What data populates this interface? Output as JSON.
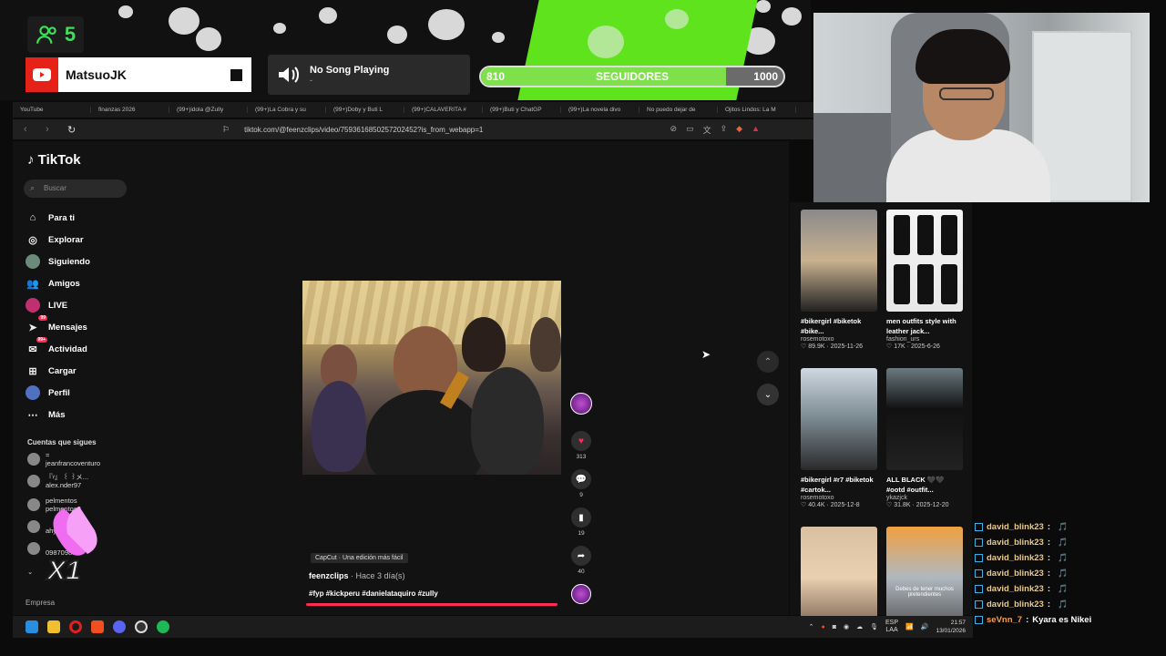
{
  "overlay": {
    "viewer_count": "5",
    "channel_name": "MatsuoJK",
    "song_title": "No Song Playing",
    "song_sub": "-",
    "goal_current": "810",
    "goal_label": "SEGUIDORES",
    "goal_target": "1000",
    "goal_progress_fraction": 0.81
  },
  "browser": {
    "tabs": [
      "YouTube",
      "finanzas 2026",
      "(99+)idola @Zully",
      "(99+)La Cobra y su",
      "(99+)Doby y Buti L",
      "(99+)CALAVERITA #",
      "(99+)Buti y ChatGP",
      "(99+)La novela divo",
      "No puedo dejar de",
      "Ojitos Lindos: La M"
    ],
    "url": "tiktok.com/@feenzclips/video/7593616850257202452?is_from_webapp=1"
  },
  "tiktok": {
    "logo": "TikTok",
    "search_placeholder": "Buscar",
    "menu": [
      {
        "label": "Para ti",
        "icon": "home-icon"
      },
      {
        "label": "Explorar",
        "icon": "compass-icon"
      },
      {
        "label": "Siguiendo",
        "icon": "avatar-icon"
      },
      {
        "label": "Amigos",
        "icon": "friends-icon"
      },
      {
        "label": "LIVE",
        "icon": "live-icon"
      },
      {
        "label": "Mensajes",
        "icon": "send-icon",
        "badge": "99"
      },
      {
        "label": "Actividad",
        "icon": "inbox-icon",
        "badge": "99+"
      },
      {
        "label": "Cargar",
        "icon": "upload-icon"
      },
      {
        "label": "Perfil",
        "icon": "profile-icon"
      },
      {
        "label": "Más",
        "icon": "more-icon"
      }
    ],
    "following_header": "Cuentas que sigues",
    "accounts": [
      {
        "line1": "=",
        "line2": "jeanfrancoventuro"
      },
      {
        "line1": "『ᵞ』 ꒰ ꒱メ...",
        "line2": "alex.nder97"
      },
      {
        "line1": "pelmentos",
        "line2": "pelmentos0"
      },
      {
        "line1": "",
        "line2": "ahyaaa"
      },
      {
        "line1": "",
        "line2": "098709877"
      }
    ],
    "footer": "Empresa",
    "video": {
      "capcut": "CapCut · Una edición más fácil",
      "author": "feenzclips",
      "time": "· Hace 3 día(s)",
      "tags": "#fyp #kickperu #danielataquiro #zully",
      "likes": "313",
      "comments": "9",
      "saves": "19",
      "shares": "40"
    },
    "grid": [
      {
        "title": "#bikergirl #biketok #bike...",
        "author": "rosemotoxo",
        "views": "89.9K",
        "date": "2025-11-26"
      },
      {
        "title": "men outfits style with leather jack...",
        "author": "fashion_urs",
        "views": "17K",
        "date": "2025-6-26"
      },
      {
        "title": "#bikergirl #r7 #biketok #cartok...",
        "author": "rosemotoxo",
        "views": "40.4K",
        "date": "2025-12-8"
      },
      {
        "title": "ALL BLACK 🖤🖤 #ootd #outfit...",
        "author": "ykazjck",
        "views": "31.8K",
        "date": "2025-12-20"
      },
      {
        "title": "",
        "author": "",
        "views": "",
        "date": ""
      },
      {
        "title": "",
        "author": "",
        "views": "",
        "date": "",
        "overlay_text": "Debes de tener muchos pretendientes"
      }
    ]
  },
  "chat": [
    {
      "user": "david_blink23",
      "text": ""
    },
    {
      "user": "david_blink23",
      "text": ""
    },
    {
      "user": "david_blink23",
      "text": ""
    },
    {
      "user": "david_blink23",
      "text": ""
    },
    {
      "user": "david_blink23",
      "text": ""
    },
    {
      "user": "david_blink23",
      "text": ""
    },
    {
      "user": "seVnn_7",
      "text": "Kyara es Nikei"
    }
  ],
  "clap_multiplier": "X1",
  "taskbar": {
    "lang": "ESP",
    "lang2": "LAA",
    "time": "21:57",
    "date": "13/01/2026"
  },
  "colors": {
    "accent": "#fe2c55",
    "green": "#5ee31c",
    "youtube": "#e62117"
  }
}
